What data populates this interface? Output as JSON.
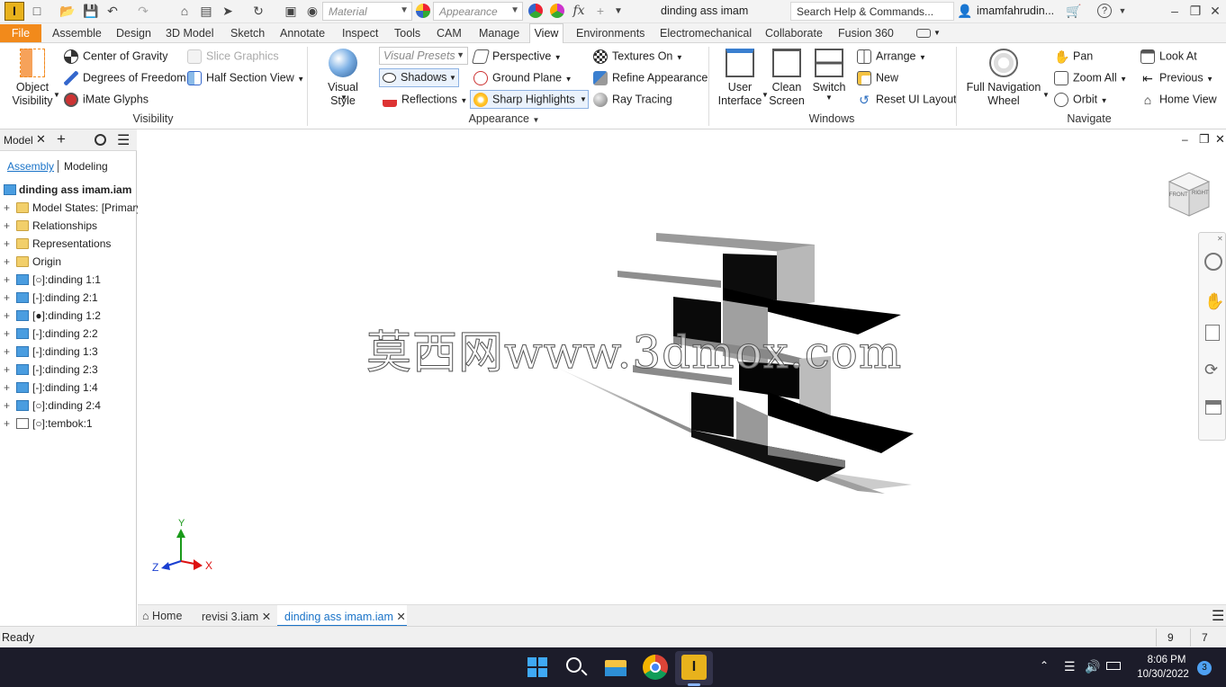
{
  "app": {
    "document_title": "dinding ass imam",
    "search_placeholder": "Search Help & Commands...",
    "user_name": "imamfahrudin...",
    "material_combo": "Material",
    "appearance_combo": "Appearance"
  },
  "tabs": [
    "File",
    "Assemble",
    "Design",
    "3D Model",
    "Sketch",
    "Annotate",
    "Inspect",
    "Tools",
    "CAM",
    "Manage",
    "View",
    "Environments",
    "Electromechanical",
    "Collaborate",
    "Fusion 360"
  ],
  "active_tab": "View",
  "ribbon": {
    "visibility": {
      "label": "Visibility",
      "object_visibility": "Object Visibility",
      "center_of_gravity": "Center of Gravity",
      "degrees_of_freedom": "Degrees of Freedom",
      "imate_glyphs": "iMate Glyphs",
      "slice_graphics": "Slice Graphics",
      "half_section_view": "Half Section View"
    },
    "appearance": {
      "label": "Appearance",
      "visual_style": "Visual Style",
      "visual_presets": "Visual Presets",
      "shadows": "Shadows",
      "reflections": "Reflections",
      "perspective": "Perspective",
      "ground_plane": "Ground Plane",
      "sharp_highlights": "Sharp Highlights",
      "textures_on": "Textures On",
      "refine_appearance": "Refine Appearance",
      "ray_tracing": "Ray Tracing"
    },
    "windows": {
      "label": "Windows",
      "user_interface": "User Interface",
      "clean_screen": "Clean Screen",
      "switch": "Switch",
      "arrange": "Arrange",
      "new": "New",
      "reset_ui_layout": "Reset UI Layout"
    },
    "navigate": {
      "label": "Navigate",
      "full_navigation_wheel": "Full Navigation Wheel",
      "pan": "Pan",
      "zoom_all": "Zoom All",
      "orbit": "Orbit",
      "look_at": "Look At",
      "previous": "Previous",
      "home_view": "Home View"
    }
  },
  "browser": {
    "tab_model": "Model",
    "sub_assembly": "Assembly",
    "sub_modeling": "Modeling",
    "root": "dinding ass imam.iam",
    "items": [
      {
        "label": "Model States: [Primary]",
        "icon": "folder"
      },
      {
        "label": "Relationships",
        "icon": "folder"
      },
      {
        "label": "Representations",
        "icon": "folder"
      },
      {
        "label": "Origin",
        "icon": "folder"
      },
      {
        "label": "[○]:dinding 1:1",
        "icon": "part"
      },
      {
        "label": "[-]:dinding 2:1",
        "icon": "part"
      },
      {
        "label": "[●]:dinding 1:2",
        "icon": "part"
      },
      {
        "label": "[-]:dinding 2:2",
        "icon": "part"
      },
      {
        "label": "[-]:dinding 1:3",
        "icon": "part"
      },
      {
        "label": "[-]:dinding 2:3",
        "icon": "part"
      },
      {
        "label": "[-]:dinding 1:4",
        "icon": "part"
      },
      {
        "label": "[○]:dinding 2:4",
        "icon": "part"
      },
      {
        "label": "[○]:tembok:1",
        "icon": "wire"
      }
    ]
  },
  "viewport": {
    "watermark": "莫西网www.3dmox.com",
    "viewcube_front": "FRONT",
    "viewcube_right": "RIGHT",
    "axis_x": "X",
    "axis_y": "Y",
    "axis_z": "Z"
  },
  "doc_tabs": {
    "home": "Home",
    "tab1": "revisi 3.iam",
    "tab2": "dinding ass imam.iam"
  },
  "status": {
    "text": "Ready",
    "count1": "9",
    "count2": "7"
  },
  "taskbar": {
    "time": "8:06 PM",
    "date": "10/30/2022",
    "notifications": "3"
  },
  "colors": {
    "file_tab": "#f28a1b",
    "accent": "#1a73c8",
    "taskbar": "#1c1c2a"
  }
}
